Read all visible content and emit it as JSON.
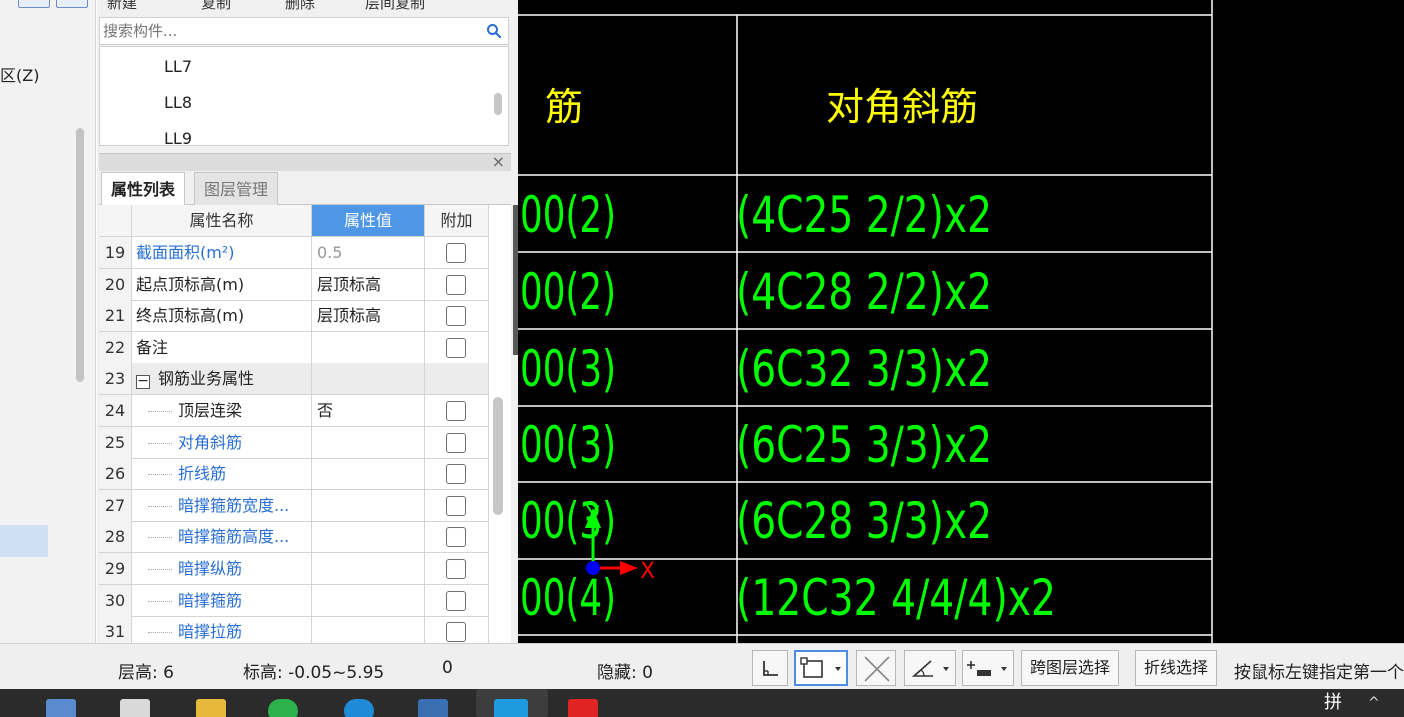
{
  "left_nav": {
    "zone_label": "区(Z)"
  },
  "component_panel": {
    "toolbar_labels": [
      "新建",
      "复制",
      "删除",
      "层间复制"
    ],
    "search_placeholder": "搜索构件...",
    "components": [
      "LL7",
      "LL8",
      "LL9"
    ]
  },
  "property_panel": {
    "tabs": [
      "属性列表",
      "图层管理"
    ],
    "columns": [
      "属性名称",
      "属性值",
      "附加"
    ],
    "rows": [
      {
        "num": "19",
        "name": "截面面积(m²)",
        "value": "0.5",
        "blue": true,
        "value_gray": true,
        "indent": false,
        "group": false,
        "checkbox": true
      },
      {
        "num": "20",
        "name": "起点顶标高(m)",
        "value": "层顶标高",
        "blue": false,
        "value_gray": false,
        "indent": false,
        "group": false,
        "checkbox": true
      },
      {
        "num": "21",
        "name": "终点顶标高(m)",
        "value": "层顶标高",
        "blue": false,
        "value_gray": false,
        "indent": false,
        "group": false,
        "checkbox": true
      },
      {
        "num": "22",
        "name": "备注",
        "value": "",
        "blue": false,
        "value_gray": false,
        "indent": false,
        "group": false,
        "checkbox": true
      },
      {
        "num": "23",
        "name": "钢筋业务属性",
        "value": "",
        "blue": false,
        "value_gray": false,
        "indent": false,
        "group": true,
        "checkbox": false
      },
      {
        "num": "24",
        "name": "顶层连梁",
        "value": "否",
        "blue": false,
        "value_gray": false,
        "indent": true,
        "group": false,
        "checkbox": true
      },
      {
        "num": "25",
        "name": "对角斜筋",
        "value": "",
        "blue": true,
        "value_gray": false,
        "indent": true,
        "group": false,
        "checkbox": true
      },
      {
        "num": "26",
        "name": "折线筋",
        "value": "",
        "blue": true,
        "value_gray": false,
        "indent": true,
        "group": false,
        "checkbox": true
      },
      {
        "num": "27",
        "name": "暗撑箍筋宽度...",
        "value": "",
        "blue": true,
        "value_gray": false,
        "indent": true,
        "group": false,
        "checkbox": true
      },
      {
        "num": "28",
        "name": "暗撑箍筋高度...",
        "value": "",
        "blue": true,
        "value_gray": false,
        "indent": true,
        "group": false,
        "checkbox": true
      },
      {
        "num": "29",
        "name": "暗撑纵筋",
        "value": "",
        "blue": true,
        "value_gray": false,
        "indent": true,
        "group": false,
        "checkbox": true
      },
      {
        "num": "30",
        "name": "暗撑箍筋",
        "value": "",
        "blue": true,
        "value_gray": false,
        "indent": true,
        "group": false,
        "checkbox": true
      },
      {
        "num": "31",
        "name": "暗撑拉筋",
        "value": "",
        "blue": true,
        "value_gray": false,
        "indent": true,
        "group": false,
        "checkbox": true
      }
    ]
  },
  "cad": {
    "header_left": "筋",
    "header_right": "对角斜筋",
    "rows": [
      {
        "left": "00(2)",
        "right": "(4C25 2/2)x2"
      },
      {
        "left": "00(2)",
        "right": "(4C28 2/2)x2"
      },
      {
        "left": "00(3)",
        "right": "(6C32 3/3)x2"
      },
      {
        "left": "00(3)",
        "right": "(6C25 3/3)x2"
      },
      {
        "left": "00(3)",
        "right": "(6C28 3/3)x2"
      },
      {
        "left": "00(4)",
        "right": "(12C32 4/4/4)x2"
      }
    ],
    "ucs_x": "X",
    "ucs_y": "Y",
    "colors": {
      "header": "#ffff00",
      "cells": "#00ff00",
      "background": "#000000"
    }
  },
  "status_bar": {
    "floor_height": "层高:  6",
    "elevation": "标高:  -0.05~5.95",
    "count": "0",
    "hidden": "隐藏:  0",
    "cross_layer_select": "跨图层选择",
    "polyline_select": "折线选择",
    "hint": "按鼠标左键指定第一个"
  },
  "taskbar": {
    "ime": "拼",
    "tray_arrow": "^"
  }
}
